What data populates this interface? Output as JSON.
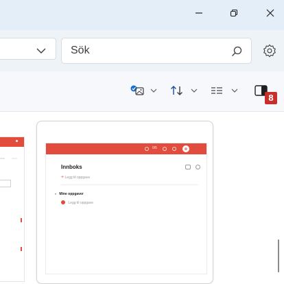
{
  "colors": {
    "accent_red": "#e24c3d",
    "badge_red": "#c62f2b",
    "titlebar_bg": "#e3eef8",
    "addressbar_bg": "#eef3f8",
    "toolbar_bg": "#f6f8fb"
  },
  "window_controls": {
    "minimize_icon": "minimize-icon",
    "maximize_icon": "restore-icon",
    "close_icon": "close-icon"
  },
  "address_bar": {
    "search_placeholder": "Sök",
    "search_icon": "search-icon",
    "settings_icon": "gear-icon"
  },
  "toolbar": {
    "buttons": [
      {
        "icon": "image-view-icon",
        "has_dropdown": true
      },
      {
        "icon": "sort-icon",
        "has_dropdown": true
      },
      {
        "icon": "layout-icon",
        "has_dropdown": true
      },
      {
        "icon": "details-pane-icon",
        "has_dropdown": false
      }
    ],
    "badge": "8"
  },
  "thumbnail": {
    "header_value": "0/5",
    "title": "Innboks",
    "add_task_1": "Legg til oppgave",
    "section_title": "Mine oppgaver",
    "add_task_2": "Legg til oppgave"
  }
}
